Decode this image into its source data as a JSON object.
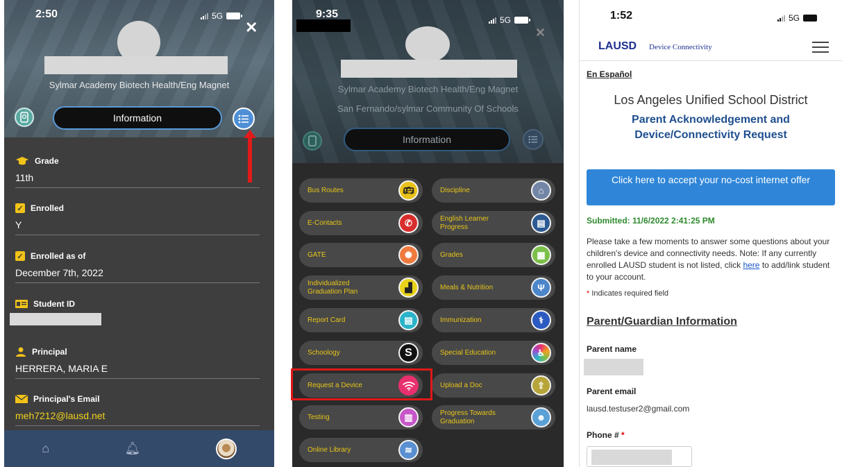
{
  "panel1": {
    "status": {
      "time": "2:50",
      "network": "5G"
    },
    "school": "Sylmar Academy Biotech Health/Eng Magnet",
    "info_label": "Information",
    "fields": [
      {
        "label": "Grade",
        "value": "11th",
        "icon": "graduation-cap-icon"
      },
      {
        "label": "Enrolled",
        "value": "Y",
        "icon": "checkbox-icon"
      },
      {
        "label": "Enrolled as of",
        "value": "December 7th, 2022",
        "icon": "checkbox-icon"
      },
      {
        "label": "Student ID",
        "value": "",
        "icon": "id-card-icon"
      },
      {
        "label": "Principal",
        "value": "HERRERA, MARIA E",
        "icon": "person-icon"
      },
      {
        "label": "Principal's Email",
        "value": "meh7212@lausd.net",
        "icon": "envelope-icon"
      }
    ],
    "colors": {
      "accent": "#f2c318",
      "bottombar": "#344a6b"
    }
  },
  "panel2": {
    "status": {
      "time": "9:35",
      "network": "5G"
    },
    "school_line1": "Sylmar Academy Biotech Health/Eng Magnet",
    "school_line2": "San Fernando/sylmar Community Of Schools",
    "info_label": "Information",
    "tiles": [
      {
        "label": "Bus Routes",
        "icon": "bus-icon",
        "color": "#e9c21a"
      },
      {
        "label": "Discipline",
        "icon": "home-icon",
        "color": "#7386a6"
      },
      {
        "label": "E-Contacts",
        "icon": "phone-icon",
        "color": "#d92d2d"
      },
      {
        "label": "English Learner Progress",
        "icon": "book-icon",
        "color": "#2c5a93"
      },
      {
        "label": "GATE",
        "icon": "wheel-icon",
        "color": "#f07b3f"
      },
      {
        "label": "Grades",
        "icon": "document-icon",
        "color": "#7cc04a"
      },
      {
        "label": "Individualized Graduation Plan",
        "icon": "plan-icon",
        "color": "#e9d21a"
      },
      {
        "label": "Meals & Nutrition",
        "icon": "utensils-icon",
        "color": "#4c86c9"
      },
      {
        "label": "Report Card",
        "icon": "report-icon",
        "color": "#2ab3c9"
      },
      {
        "label": "Immunization",
        "icon": "caduceus-icon",
        "color": "#2b5ac0"
      },
      {
        "label": "Schoology",
        "icon": "schoology-icon",
        "color": "#111111"
      },
      {
        "label": "Special Education",
        "icon": "accessibility-icon",
        "color": "#9b4fd1"
      },
      {
        "label": "Request a Device",
        "icon": "wifi-icon",
        "color": "#e8306f"
      },
      {
        "label": "Upload a Doc",
        "icon": "upload-icon",
        "color": "#b7a53a"
      },
      {
        "label": "Testing",
        "icon": "test-icon",
        "color": "#c757c9"
      },
      {
        "label": "Progress Towards Graduation",
        "icon": "graduate-icon",
        "color": "#5aa1d6"
      },
      {
        "label": "Online Library",
        "icon": "books-icon",
        "color": "#5a8fd1"
      }
    ]
  },
  "panel3": {
    "status": {
      "time": "1:52",
      "network": "5G"
    },
    "logo": "LAUSD",
    "header_text": "Device Connectivity",
    "spanish_link": "En Español",
    "district": "Los Angeles Unified School District",
    "title": "Parent Acknowledgement and Device/Connectivity Request",
    "cta": "Click here to accept your no-cost internet offer",
    "submitted": "Submitted: 11/6/2022 2:41:25 PM",
    "intro_before": "Please take a few moments to answer some questions about your children's device and connectivity needs. Note: If any currently enrolled LAUSD student is not listed, click ",
    "intro_link": "here",
    "intro_after": " to add/link student to your account.",
    "required_note": "Indicates required field",
    "section": "Parent/Guardian Information",
    "parent_name_label": "Parent name",
    "parent_email_label": "Parent email",
    "parent_email_value": "lausd.testuser2@gmail.com",
    "phone_label": "Phone #",
    "required_star": "*"
  }
}
